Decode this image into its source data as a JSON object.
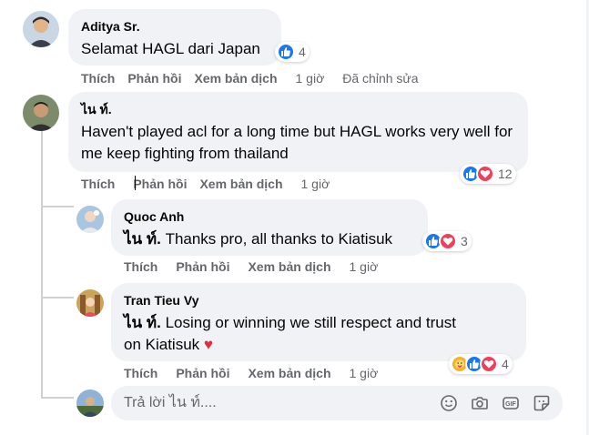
{
  "comments": [
    {
      "author": "Aditya Sr.",
      "text": "Selamat HAGL dari Japan",
      "reactions": {
        "count": "4",
        "icons": [
          "like-icon"
        ]
      },
      "actions": {
        "like": "Thích",
        "reply": "Phản hồi",
        "translate": "Xem bản dịch",
        "time": "1 giờ",
        "edited": "Đã chỉnh sửa"
      }
    },
    {
      "author": "ไน ท์.",
      "text": "Haven't played acl for a long time but HAGL works very well for me keep fighting from thailand",
      "reactions": {
        "count": "12",
        "icons": [
          "like-icon",
          "love-icon"
        ]
      },
      "actions": {
        "like": "Thích",
        "reply": "Phản hồi",
        "translate": "Xem bản dịch",
        "time": "1 giờ"
      }
    }
  ],
  "replies": [
    {
      "author": "Quoc Anh",
      "mention": "ไน ท์.",
      "text": "Thanks pro, all thanks to Kiatisuk",
      "reactions": {
        "count": "3",
        "icons": [
          "like-icon",
          "love-icon"
        ]
      },
      "actions": {
        "like": "Thích",
        "reply": "Phản hồi",
        "translate": "Xem bản dịch",
        "time": "1 giờ"
      }
    },
    {
      "author": "Tran Tieu Vy",
      "mention": "ไน ท์.",
      "text_line1": "Losing or winning we still respect and trust",
      "text_line2": "on Kiatisuk",
      "emoji": "♥",
      "reactions": {
        "count": "4",
        "icons": [
          "care-icon",
          "like-icon",
          "love-icon"
        ]
      },
      "actions": {
        "like": "Thích",
        "reply": "Phản hồi",
        "translate": "Xem bản dịch",
        "time": "1 giờ"
      }
    }
  ],
  "reply_box": {
    "placeholder": "Trả lời ไน ท์....",
    "tools": [
      "emoji-icon",
      "camera-icon",
      "gif-icon",
      "sticker-icon"
    ]
  },
  "colors": {
    "bubble": "#f0f2f5",
    "secondary_text": "#65676b",
    "like": "#1877f2",
    "love": "#f33e58",
    "care": "#f7b125"
  }
}
